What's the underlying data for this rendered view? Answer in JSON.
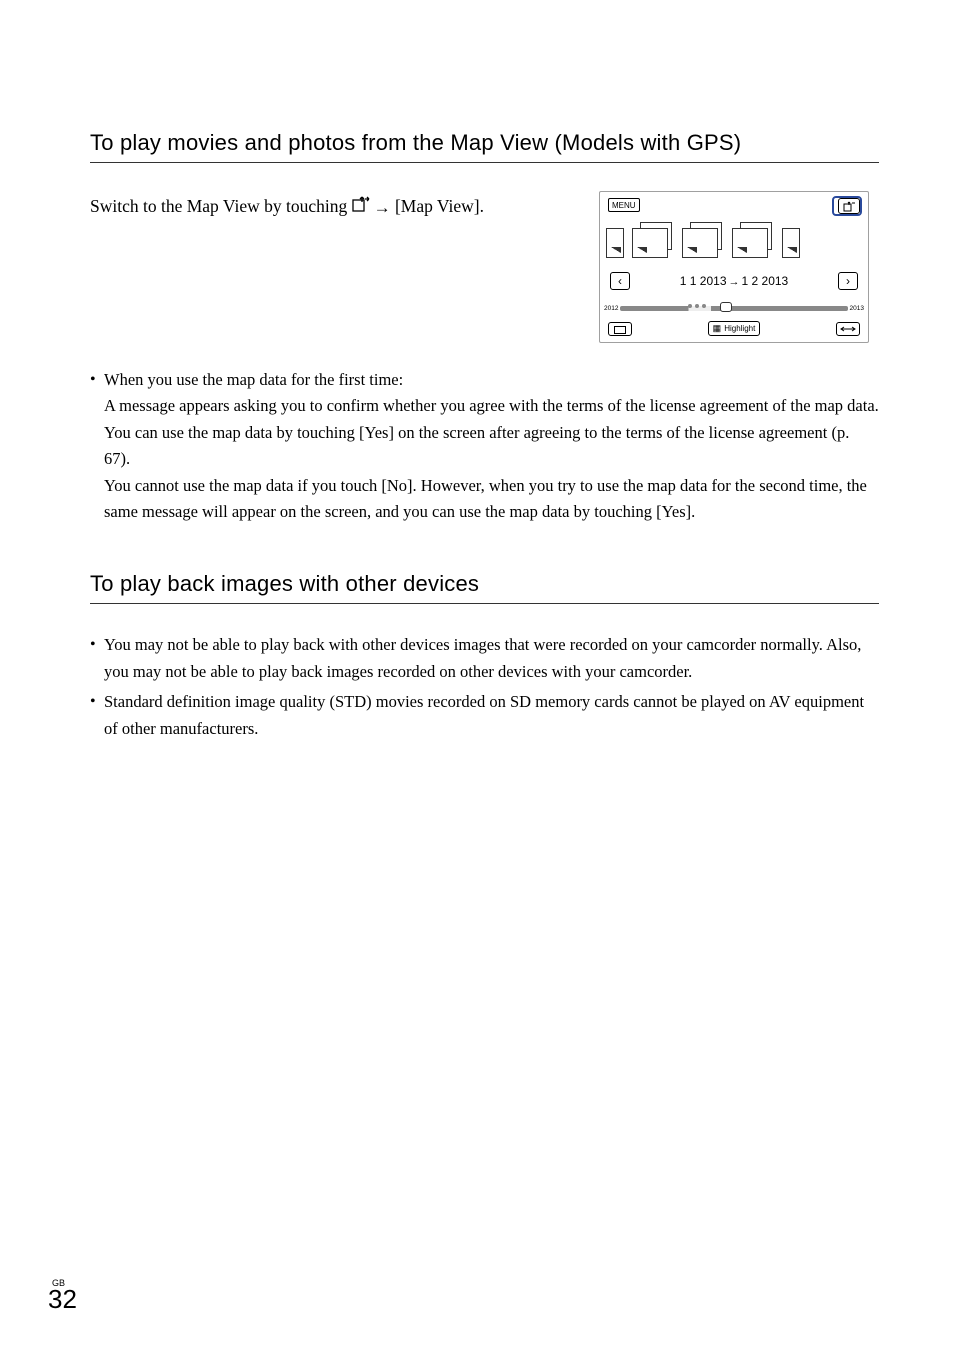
{
  "section1": {
    "heading": "To play movies and photos from the Map View (Models with GPS)",
    "intro_pre": "Switch to the Map View by touching ",
    "intro_post": " [Map View].",
    "screenshot": {
      "menu_label": "MENU",
      "date_from": "1 1 2013",
      "date_to": "1 2 2013",
      "year_left": "2012",
      "year_right": "2013",
      "highlight_label": "Highlight"
    },
    "bullet_title": "When you use the map data for the first time:",
    "bullet_body": "A message appears asking you to confirm whether you agree with the terms of the license agreement of the map data. You can use the map data by touching [Yes] on the screen after agreeing to the terms of the license agreement (p. 67).\nYou cannot use the map data if you touch [No]. However, when you try to use the map data for the second time, the same message will appear on the screen, and you can use the map data by touching [Yes]."
  },
  "section2": {
    "heading": "To play back images with other devices",
    "bullets": [
      "You may not be able to play back with other devices images that were recorded on your camcorder normally.  Also, you may not be able to  play back images recorded on other devices with your camcorder.",
      "Standard definition image quality (STD) movies recorded on SD memory cards cannot be played on AV equipment of other manufacturers."
    ]
  },
  "footer": {
    "region": "GB",
    "page": "32"
  }
}
